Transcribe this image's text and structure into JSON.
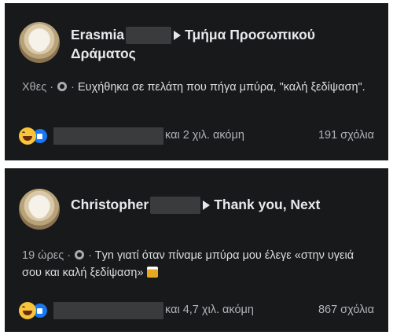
{
  "posts": [
    {
      "author": "Erasmia",
      "group_line1": "Τμήμα Προσωπικού",
      "group_line2": "Δράματος",
      "time": "Χθες",
      "separator": "·",
      "text": "Ευχήθηκα σε πελάτη που πήγα μπύρα, \"καλή ξεδίψαση\".",
      "reactions_more": "και 2 χιλ. ακόμη",
      "comments": "191 σχόλια"
    },
    {
      "author": "Christopher",
      "group_line1": "Thank you, Next",
      "time": "19 ώρες",
      "separator": "·",
      "text": "Τyn γιατί όταν πίναμε μπύρα μου έλεγε «στην υγειά σου και καλή ξεδίψαση»",
      "reactions_more": "και 4,7 χιλ. ακόμη",
      "comments": "867 σχόλια"
    }
  ],
  "icons": {
    "reaction_1": "haha-icon",
    "reaction_2": "like-icon",
    "privacy": "globe-icon",
    "emoji": "beer-icon"
  },
  "colors": {
    "card_bg": "#18191a",
    "like_blue": "#1877f2",
    "haha_yellow": "#f7c43a"
  }
}
